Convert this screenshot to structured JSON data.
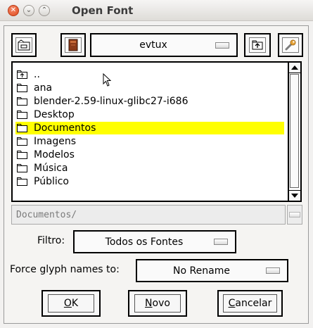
{
  "window": {
    "title": "Open Font"
  },
  "toolbar": {
    "directory": "evtux"
  },
  "file_list": {
    "items": [
      {
        "name": "..",
        "type": "parent",
        "selected": false
      },
      {
        "name": "ana",
        "type": "folder",
        "selected": false
      },
      {
        "name": "blender-2.59-linux-glibc27-i686",
        "type": "folder",
        "selected": false
      },
      {
        "name": "Desktop",
        "type": "folder",
        "selected": false
      },
      {
        "name": "Documentos",
        "type": "folder",
        "selected": true
      },
      {
        "name": "Imagens",
        "type": "folder",
        "selected": false
      },
      {
        "name": "Modelos",
        "type": "folder",
        "selected": false
      },
      {
        "name": "Música",
        "type": "folder",
        "selected": false
      },
      {
        "name": "Público",
        "type": "folder",
        "selected": false
      }
    ]
  },
  "path_field": {
    "value": "Documentos/"
  },
  "filter": {
    "label": "Filtro:",
    "value": "Todos os Fontes"
  },
  "glyph_names": {
    "label": "Force glyph names to:",
    "value": "No Rename"
  },
  "buttons": {
    "ok_underline": "O",
    "ok_rest": "K",
    "new_underline": "N",
    "new_rest": "ovo",
    "cancel_underline": "C",
    "cancel_rest": "ancelar"
  },
  "colors": {
    "selection": "#ffff00",
    "close_button": "#df4a1c"
  }
}
